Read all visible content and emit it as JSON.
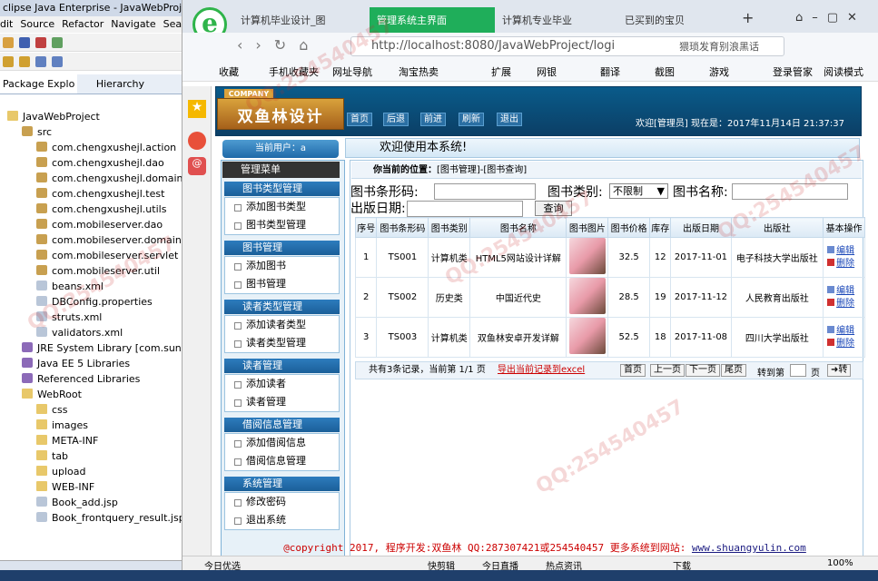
{
  "eclipse": {
    "title": "clipse Java Enterprise - JavaWebProject/s",
    "menu": [
      "dit",
      "Source",
      "Refactor",
      "Navigate",
      "Sea"
    ],
    "tabs": [
      "Package Explo",
      "Hierarchy"
    ],
    "tree": [
      {
        "t": "JavaWebProject",
        "i": "fd",
        "d": 0
      },
      {
        "t": "src",
        "i": "pk",
        "d": 1
      },
      {
        "t": "com.chengxushejl.action",
        "i": "pk",
        "d": 2
      },
      {
        "t": "com.chengxushejl.dao",
        "i": "pk",
        "d": 2
      },
      {
        "t": "com.chengxushejl.domain",
        "i": "pk",
        "d": 2
      },
      {
        "t": "com.chengxushejl.test",
        "i": "pk",
        "d": 2
      },
      {
        "t": "com.chengxushejl.utils",
        "i": "pk",
        "d": 2
      },
      {
        "t": "com.mobileserver.dao",
        "i": "pk",
        "d": 2
      },
      {
        "t": "com.mobileserver.domain",
        "i": "pk",
        "d": 2
      },
      {
        "t": "com.mobileserver.servlet",
        "i": "pk",
        "d": 2
      },
      {
        "t": "com.mobileserver.util",
        "i": "pk",
        "d": 2
      },
      {
        "t": "beans.xml",
        "i": "fl",
        "d": 2
      },
      {
        "t": "DBConfig.properties",
        "i": "fl",
        "d": 2
      },
      {
        "t": "struts.xml",
        "i": "fl",
        "d": 2
      },
      {
        "t": "validators.xml",
        "i": "fl",
        "d": 2
      },
      {
        "t": "JRE System Library [com.sun.java",
        "i": "jr",
        "d": 1
      },
      {
        "t": "Java EE 5 Libraries",
        "i": "jr",
        "d": 1
      },
      {
        "t": "Referenced Libraries",
        "i": "jr",
        "d": 1
      },
      {
        "t": "WebRoot",
        "i": "fd",
        "d": 1
      },
      {
        "t": "css",
        "i": "fd",
        "d": 2
      },
      {
        "t": "images",
        "i": "fd",
        "d": 2
      },
      {
        "t": "META-INF",
        "i": "fd",
        "d": 2
      },
      {
        "t": "tab",
        "i": "fd",
        "d": 2
      },
      {
        "t": "upload",
        "i": "fd",
        "d": 2
      },
      {
        "t": "WEB-INF",
        "i": "fd",
        "d": 2
      },
      {
        "t": "Book_add.jsp",
        "i": "fl",
        "d": 2
      },
      {
        "t": "Book_frontquery_result.jsp",
        "i": "fl",
        "d": 2
      }
    ]
  },
  "browser": {
    "tabs": [
      "计算机毕业设计_图",
      "管理系统主界面",
      "计算机专业毕业",
      "已买到的宝贝"
    ],
    "url": "http://localhost:8080/JavaWebProject/logi",
    "search": "猥琐发育别浪黑话",
    "favs": [
      "收藏",
      "手机收藏夹",
      "网址导航",
      "淘宝热卖",
      "扩展",
      "网银",
      "翻译",
      "截图",
      "游戏",
      "登录管家",
      "阅读模式"
    ]
  },
  "app": {
    "company": "COMPANY",
    "logo": "双鱼林设计",
    "nav": [
      "首页",
      "后退",
      "前进",
      "刷新",
      "退出"
    ],
    "welcome_top": "欢迎[管理员]  现在是：2017年11月14日 21:37:37",
    "current_user": "当前用户：a",
    "welcome": "欢迎使用本系统!",
    "menu_header": "管理菜单",
    "sections": [
      {
        "title": "图书类型管理",
        "items": [
          "添加图书类型",
          "图书类型管理"
        ]
      },
      {
        "title": "图书管理",
        "items": [
          "添加图书",
          "图书管理"
        ]
      },
      {
        "title": "读者类型管理",
        "items": [
          "添加读者类型",
          "读者类型管理"
        ]
      },
      {
        "title": "读者管理",
        "items": [
          "添加读者",
          "读者管理"
        ]
      },
      {
        "title": "借阅信息管理",
        "items": [
          "添加借阅信息",
          "借阅信息管理"
        ]
      },
      {
        "title": "系统管理",
        "items": [
          "修改密码",
          "退出系统"
        ]
      }
    ],
    "location_label": "你当前的位置：",
    "location": "[图书管理]-[图书查询]",
    "query": {
      "barcode_label": "图书条形码:",
      "type_label": "图书类别:",
      "type_value": "不限制",
      "name_label": "图书名称:",
      "date_label": "出版日期:",
      "query_btn": "查询"
    },
    "headers": [
      "序号",
      "图书条形码",
      "图书类别",
      "图书名称",
      "图书图片",
      "图书价格",
      "库存",
      "出版日期",
      "出版社",
      "基本操作"
    ],
    "rows": [
      [
        "1",
        "TS001",
        "计算机类",
        "HTML5网站设计详解",
        "",
        "32.5",
        "12",
        "2017-11-01",
        "电子科技大学出版社"
      ],
      [
        "2",
        "TS002",
        "历史类",
        "中国近代史",
        "",
        "28.5",
        "19",
        "2017-11-12",
        "人民教育出版社"
      ],
      [
        "3",
        "TS003",
        "计算机类",
        "双鱼林安卓开发详解",
        "",
        "52.5",
        "18",
        "2017-11-08",
        "四川大学出版社"
      ]
    ],
    "edit": "编辑",
    "del": "删除",
    "pager": {
      "summary": "共有3条记录，当前第 1/1 页",
      "export": "导出当前记录到excel",
      "first": "首页",
      "prev": "上一页",
      "next": "下一页",
      "last": "尾页",
      "goto": "转到第",
      "page": "页",
      "go": "转"
    },
    "footer": "@copyright 2017, 程序开发:双鱼林  QQ:287307421或254540457  更多系统到网站:",
    "footer_link": "www.shuangyulin.com"
  },
  "status": [
    "今日优选",
    "快剪辑",
    "今日直播",
    "热点资讯",
    "下载",
    "100%"
  ]
}
